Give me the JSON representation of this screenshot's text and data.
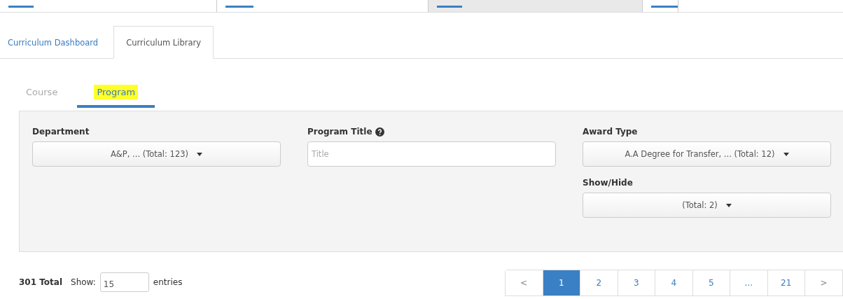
{
  "main_tabs": [
    {
      "label": "Curriculum Dashboard",
      "selected": false
    },
    {
      "label": "Curriculum Library",
      "selected": true
    }
  ],
  "sub_tabs": [
    {
      "label": "Course",
      "selected": false,
      "highlighted": false
    },
    {
      "label": "Program",
      "selected": true,
      "highlighted": true
    }
  ],
  "filters": [
    {
      "kind": "select",
      "label": "Department",
      "value": "A&P, ... (Total: 123)"
    },
    {
      "kind": "text",
      "label": "Program Title",
      "help": true,
      "placeholder": "Title"
    },
    {
      "kind": "select",
      "label": "Award Type",
      "value": "A.A Degree for Transfer, ... (Total: 12)"
    },
    {
      "kind": "select",
      "label": "Show/Hide",
      "value": "(Total: 2)"
    }
  ],
  "footer": {
    "total": "301 Total",
    "show_label": "Show:",
    "page_size": "15",
    "entries_label": "entries"
  },
  "pagination": [
    {
      "label": "<",
      "selected": false
    },
    {
      "label": "1",
      "selected": true
    },
    {
      "label": "2",
      "selected": false
    },
    {
      "label": "3",
      "selected": false
    },
    {
      "label": "4",
      "selected": false
    },
    {
      "label": "5",
      "selected": false
    },
    {
      "label": "...",
      "selected": false
    },
    {
      "label": "21",
      "selected": false
    },
    {
      "label": ">",
      "selected": false
    }
  ]
}
